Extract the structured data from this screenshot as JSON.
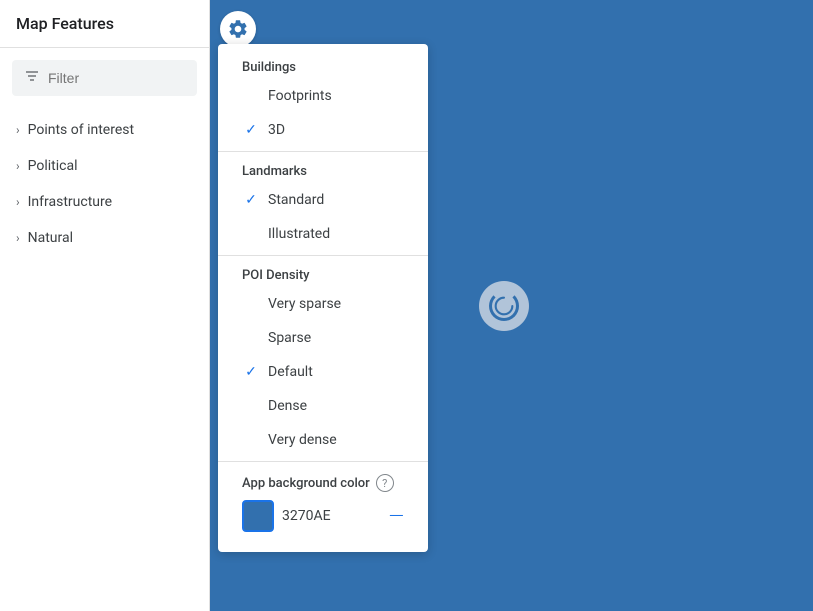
{
  "sidebar": {
    "title": "Map Features",
    "filter": {
      "placeholder": "Filter"
    },
    "items": [
      {
        "id": "points-of-interest",
        "label": "Points of interest"
      },
      {
        "id": "political",
        "label": "Political"
      },
      {
        "id": "infrastructure",
        "label": "Infrastructure"
      },
      {
        "id": "natural",
        "label": "Natural"
      }
    ]
  },
  "gear_button": {
    "aria_label": "Settings"
  },
  "dropdown": {
    "sections": {
      "buildings": {
        "label": "Buildings",
        "items": [
          {
            "id": "footprints",
            "label": "Footprints",
            "checked": false
          },
          {
            "id": "3d",
            "label": "3D",
            "checked": true
          }
        ]
      },
      "landmarks": {
        "label": "Landmarks",
        "items": [
          {
            "id": "standard",
            "label": "Standard",
            "checked": true
          },
          {
            "id": "illustrated",
            "label": "Illustrated",
            "checked": false
          }
        ]
      },
      "poi_density": {
        "label": "POI Density",
        "items": [
          {
            "id": "very-sparse",
            "label": "Very sparse",
            "checked": false
          },
          {
            "id": "sparse",
            "label": "Sparse",
            "checked": false
          },
          {
            "id": "default",
            "label": "Default",
            "checked": true
          },
          {
            "id": "dense",
            "label": "Dense",
            "checked": false
          },
          {
            "id": "very-dense",
            "label": "Very dense",
            "checked": false
          }
        ]
      }
    },
    "app_background_color": {
      "label": "App background color",
      "help_icon": "?",
      "color_value": "3270AE",
      "color_hex": "#3270AE",
      "reset_label": "—"
    }
  },
  "map": {
    "background_color": "#3270AE",
    "spinner_label": "C"
  }
}
